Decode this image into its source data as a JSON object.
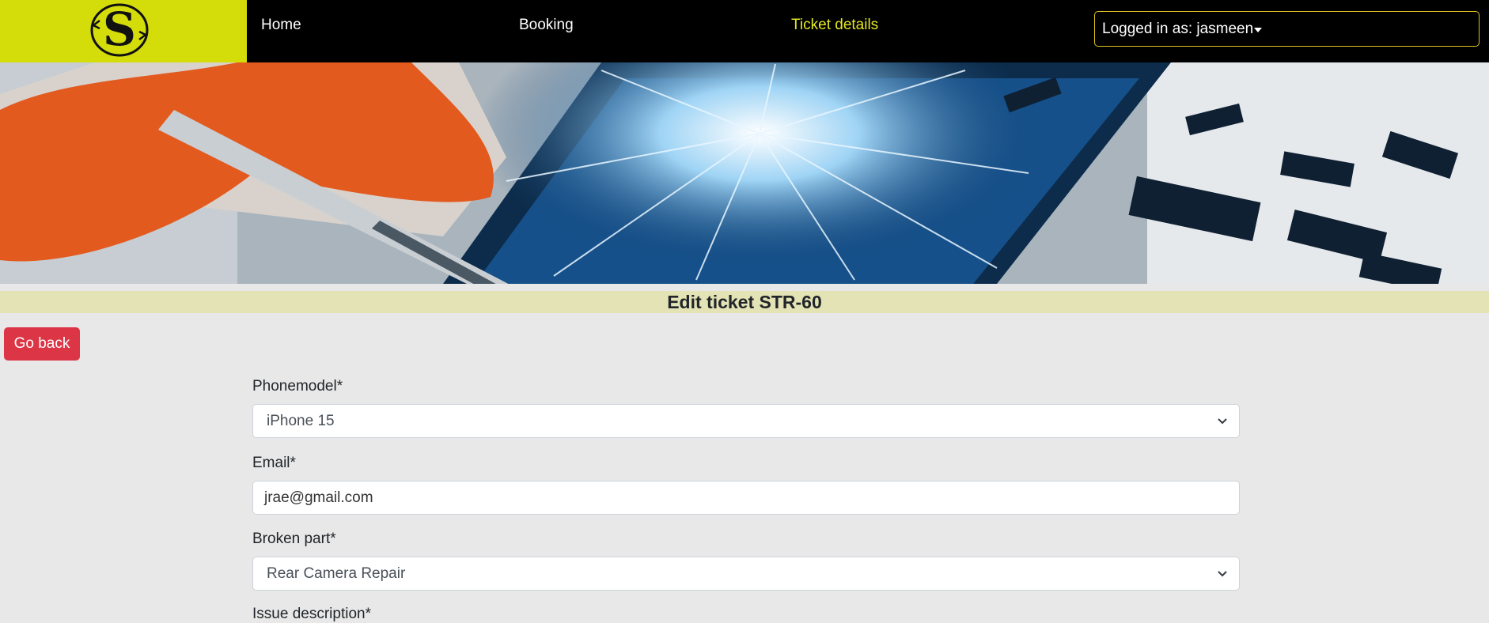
{
  "nav": {
    "home": "Home",
    "booking": "Booking",
    "ticket_details": "Ticket details",
    "user_label": "Logged in as: jasmeen"
  },
  "page": {
    "title": "Edit ticket STR-60",
    "back_label": "Go back"
  },
  "form": {
    "phonemodel_label": "Phonemodel*",
    "phonemodel_value": "iPhone 15",
    "email_label": "Email*",
    "email_value": "jrae@gmail.com",
    "broken_part_label": "Broken part*",
    "broken_part_value": "Rear Camera Repair",
    "issue_label": "Issue description*"
  },
  "colors": {
    "logo_bg": "#d4dc0a",
    "active_nav": "#e3e81f",
    "danger": "#dc3545",
    "title_strip": "#e3e3b5"
  },
  "icons": [
    "logo-s-icon",
    "caret-down-icon",
    "chevron-down-icon"
  ]
}
